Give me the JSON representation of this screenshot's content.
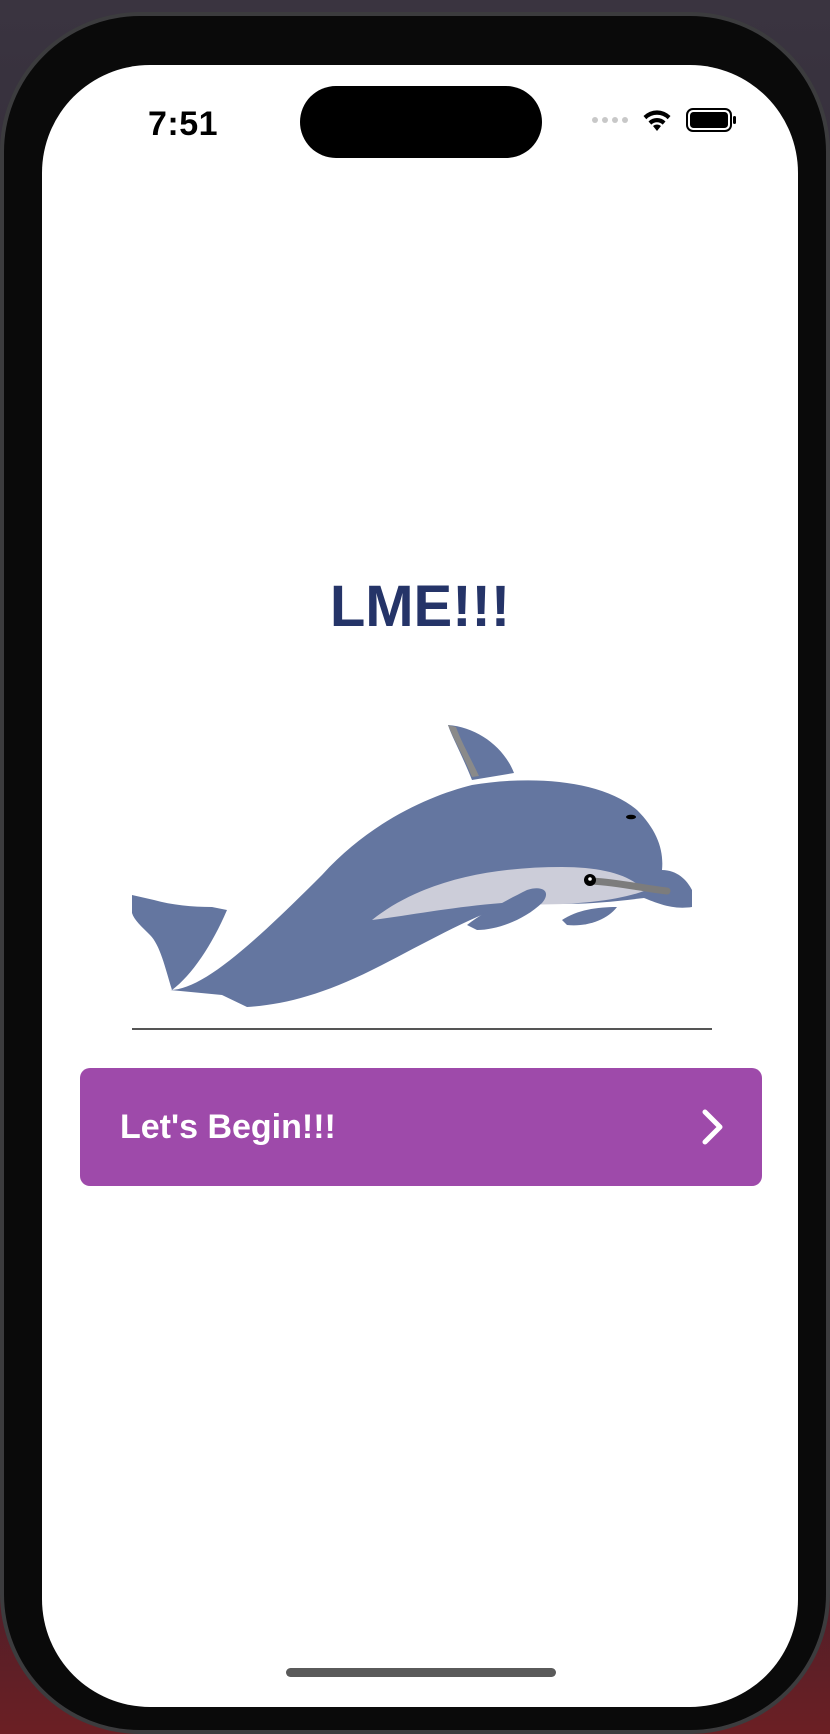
{
  "status_bar": {
    "time": "7:51"
  },
  "main": {
    "title": "LME!!!",
    "begin_button_label": "Let's Begin!!!"
  },
  "icons": {
    "wifi": "wifi-icon",
    "battery": "battery-icon",
    "signal": "cellular-signal-icon",
    "chevron": "chevron-right-icon",
    "illustration": "dolphin-illustration"
  },
  "colors": {
    "title": "#253468",
    "button": "#9e4aaa",
    "dolphin_body": "#6476a0",
    "dolphin_belly": "#cccdd9"
  }
}
